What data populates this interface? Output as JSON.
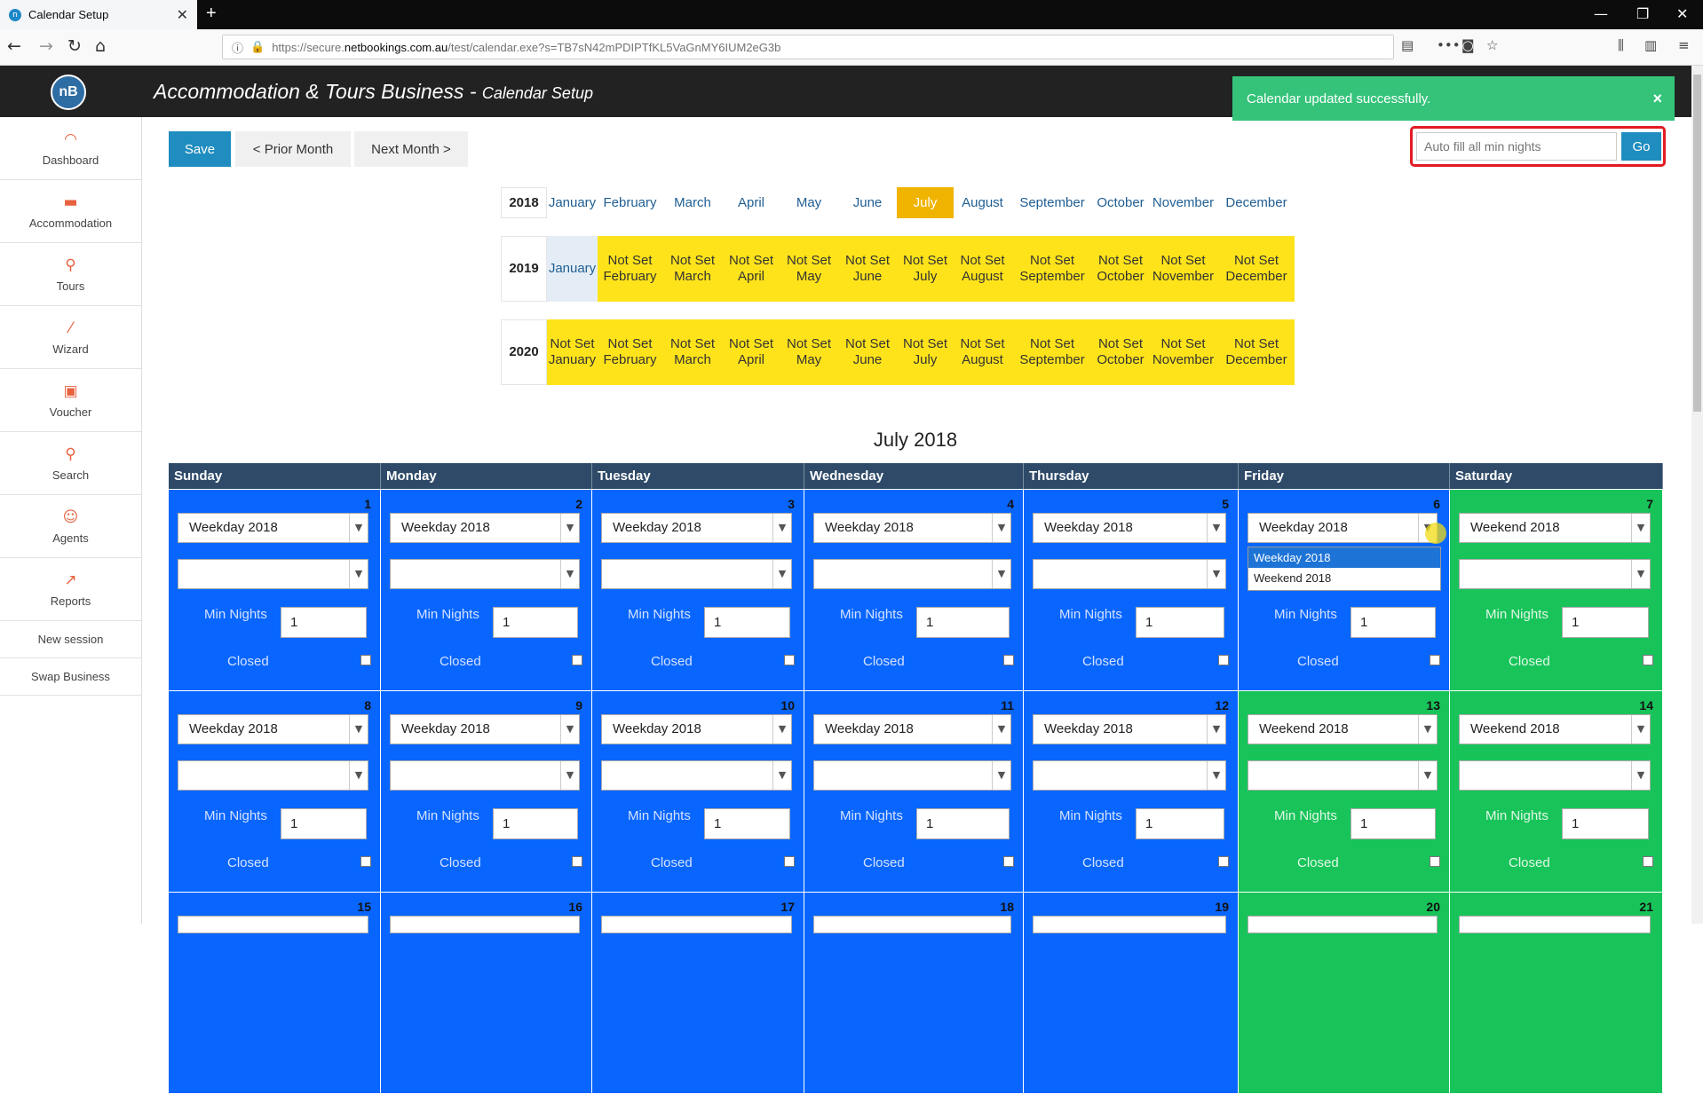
{
  "browser": {
    "tab_title": "Calendar Setup",
    "url_prefix": "https://secure.",
    "url_domain": "netbookings.com.au",
    "url_rest": "/test/calendar.exe?s=TB7sN42mPDIPTfKL5VaGnMY6IUM2eG3b"
  },
  "app": {
    "logo": "nB",
    "title": "Accommodation & Tours Business -",
    "subtitle": "Calendar Setup",
    "toast": "Calendar updated successfully."
  },
  "sidebar": [
    {
      "label": "Dashboard",
      "icon": "dashboard-icon"
    },
    {
      "label": "Accommodation",
      "icon": "bed-icon"
    },
    {
      "label": "Tours",
      "icon": "tours-icon"
    },
    {
      "label": "Wizard",
      "icon": "wand-icon"
    },
    {
      "label": "Voucher",
      "icon": "gift-icon"
    },
    {
      "label": "Search",
      "icon": "search-icon"
    },
    {
      "label": "Agents",
      "icon": "agents-icon"
    },
    {
      "label": "Reports",
      "icon": "chart-icon"
    },
    {
      "label": "New session"
    },
    {
      "label": "Swap Business"
    }
  ],
  "toolbar": {
    "save": "Save",
    "prior": "< Prior Month",
    "next": "Next Month >",
    "autofill_placeholder": "Auto fill all min nights",
    "go": "Go"
  },
  "years": [
    {
      "year": "2018",
      "months": [
        "January",
        "February",
        "March",
        "April",
        "May",
        "June",
        "July",
        "August",
        "September",
        "October",
        "November",
        "December"
      ],
      "current": 6
    },
    {
      "year": "2019",
      "months": [
        "January",
        "Not Set February",
        "Not Set March",
        "Not Set April",
        "Not Set May",
        "Not Set June",
        "Not Set July",
        "Not Set August",
        "Not Set September",
        "Not Set October",
        "Not Set November",
        "Not Set December"
      ]
    },
    {
      "year": "2020",
      "months": [
        "Not Set January",
        "Not Set February",
        "Not Set March",
        "Not Set April",
        "Not Set May",
        "Not Set June",
        "Not Set July",
        "Not Set August",
        "Not Set September",
        "Not Set October",
        "Not Set November",
        "Not Set December"
      ]
    }
  ],
  "calendar": {
    "title": "July 2018",
    "weekdays": [
      "Sunday",
      "Monday",
      "Tuesday",
      "Wednesday",
      "Thursday",
      "Friday",
      "Saturday"
    ],
    "min_nights_label": "Min Nights",
    "closed_label": "Closed",
    "weeks": [
      [
        {
          "day": "1",
          "rate": "Weekday 2018",
          "min": "1"
        },
        {
          "day": "2",
          "rate": "Weekday 2018",
          "min": "1"
        },
        {
          "day": "3",
          "rate": "Weekday 2018",
          "min": "1"
        },
        {
          "day": "4",
          "rate": "Weekday 2018",
          "min": "1"
        },
        {
          "day": "5",
          "rate": "Weekday 2018",
          "min": "1"
        },
        {
          "day": "6",
          "rate": "Weekday 2018",
          "min": "1"
        },
        {
          "day": "7",
          "rate": "Weekend 2018",
          "min": "1",
          "weekend": true
        }
      ],
      [
        {
          "day": "8",
          "rate": "Weekday 2018",
          "min": "1"
        },
        {
          "day": "9",
          "rate": "Weekday 2018",
          "min": "1"
        },
        {
          "day": "10",
          "rate": "Weekday 2018",
          "min": "1"
        },
        {
          "day": "11",
          "rate": "Weekday 2018",
          "min": "1"
        },
        {
          "day": "12",
          "rate": "Weekday 2018",
          "min": "1"
        },
        {
          "day": "13",
          "rate": "Weekend 2018",
          "min": "1",
          "weekend": true
        },
        {
          "day": "14",
          "rate": "Weekend 2018",
          "min": "1",
          "weekend": true
        }
      ],
      [
        {
          "day": "15"
        },
        {
          "day": "16"
        },
        {
          "day": "17"
        },
        {
          "day": "18"
        },
        {
          "day": "19"
        },
        {
          "day": "20",
          "weekend": true
        },
        {
          "day": "21",
          "weekend": true
        }
      ]
    ],
    "dropdown_options": [
      "Weekday 2018",
      "Weekend 2018"
    ]
  },
  "colors": {
    "weekday": "#0866ff",
    "weekend": "#18c45a",
    "notset": "#ffe31a",
    "current": "#f0b400"
  }
}
